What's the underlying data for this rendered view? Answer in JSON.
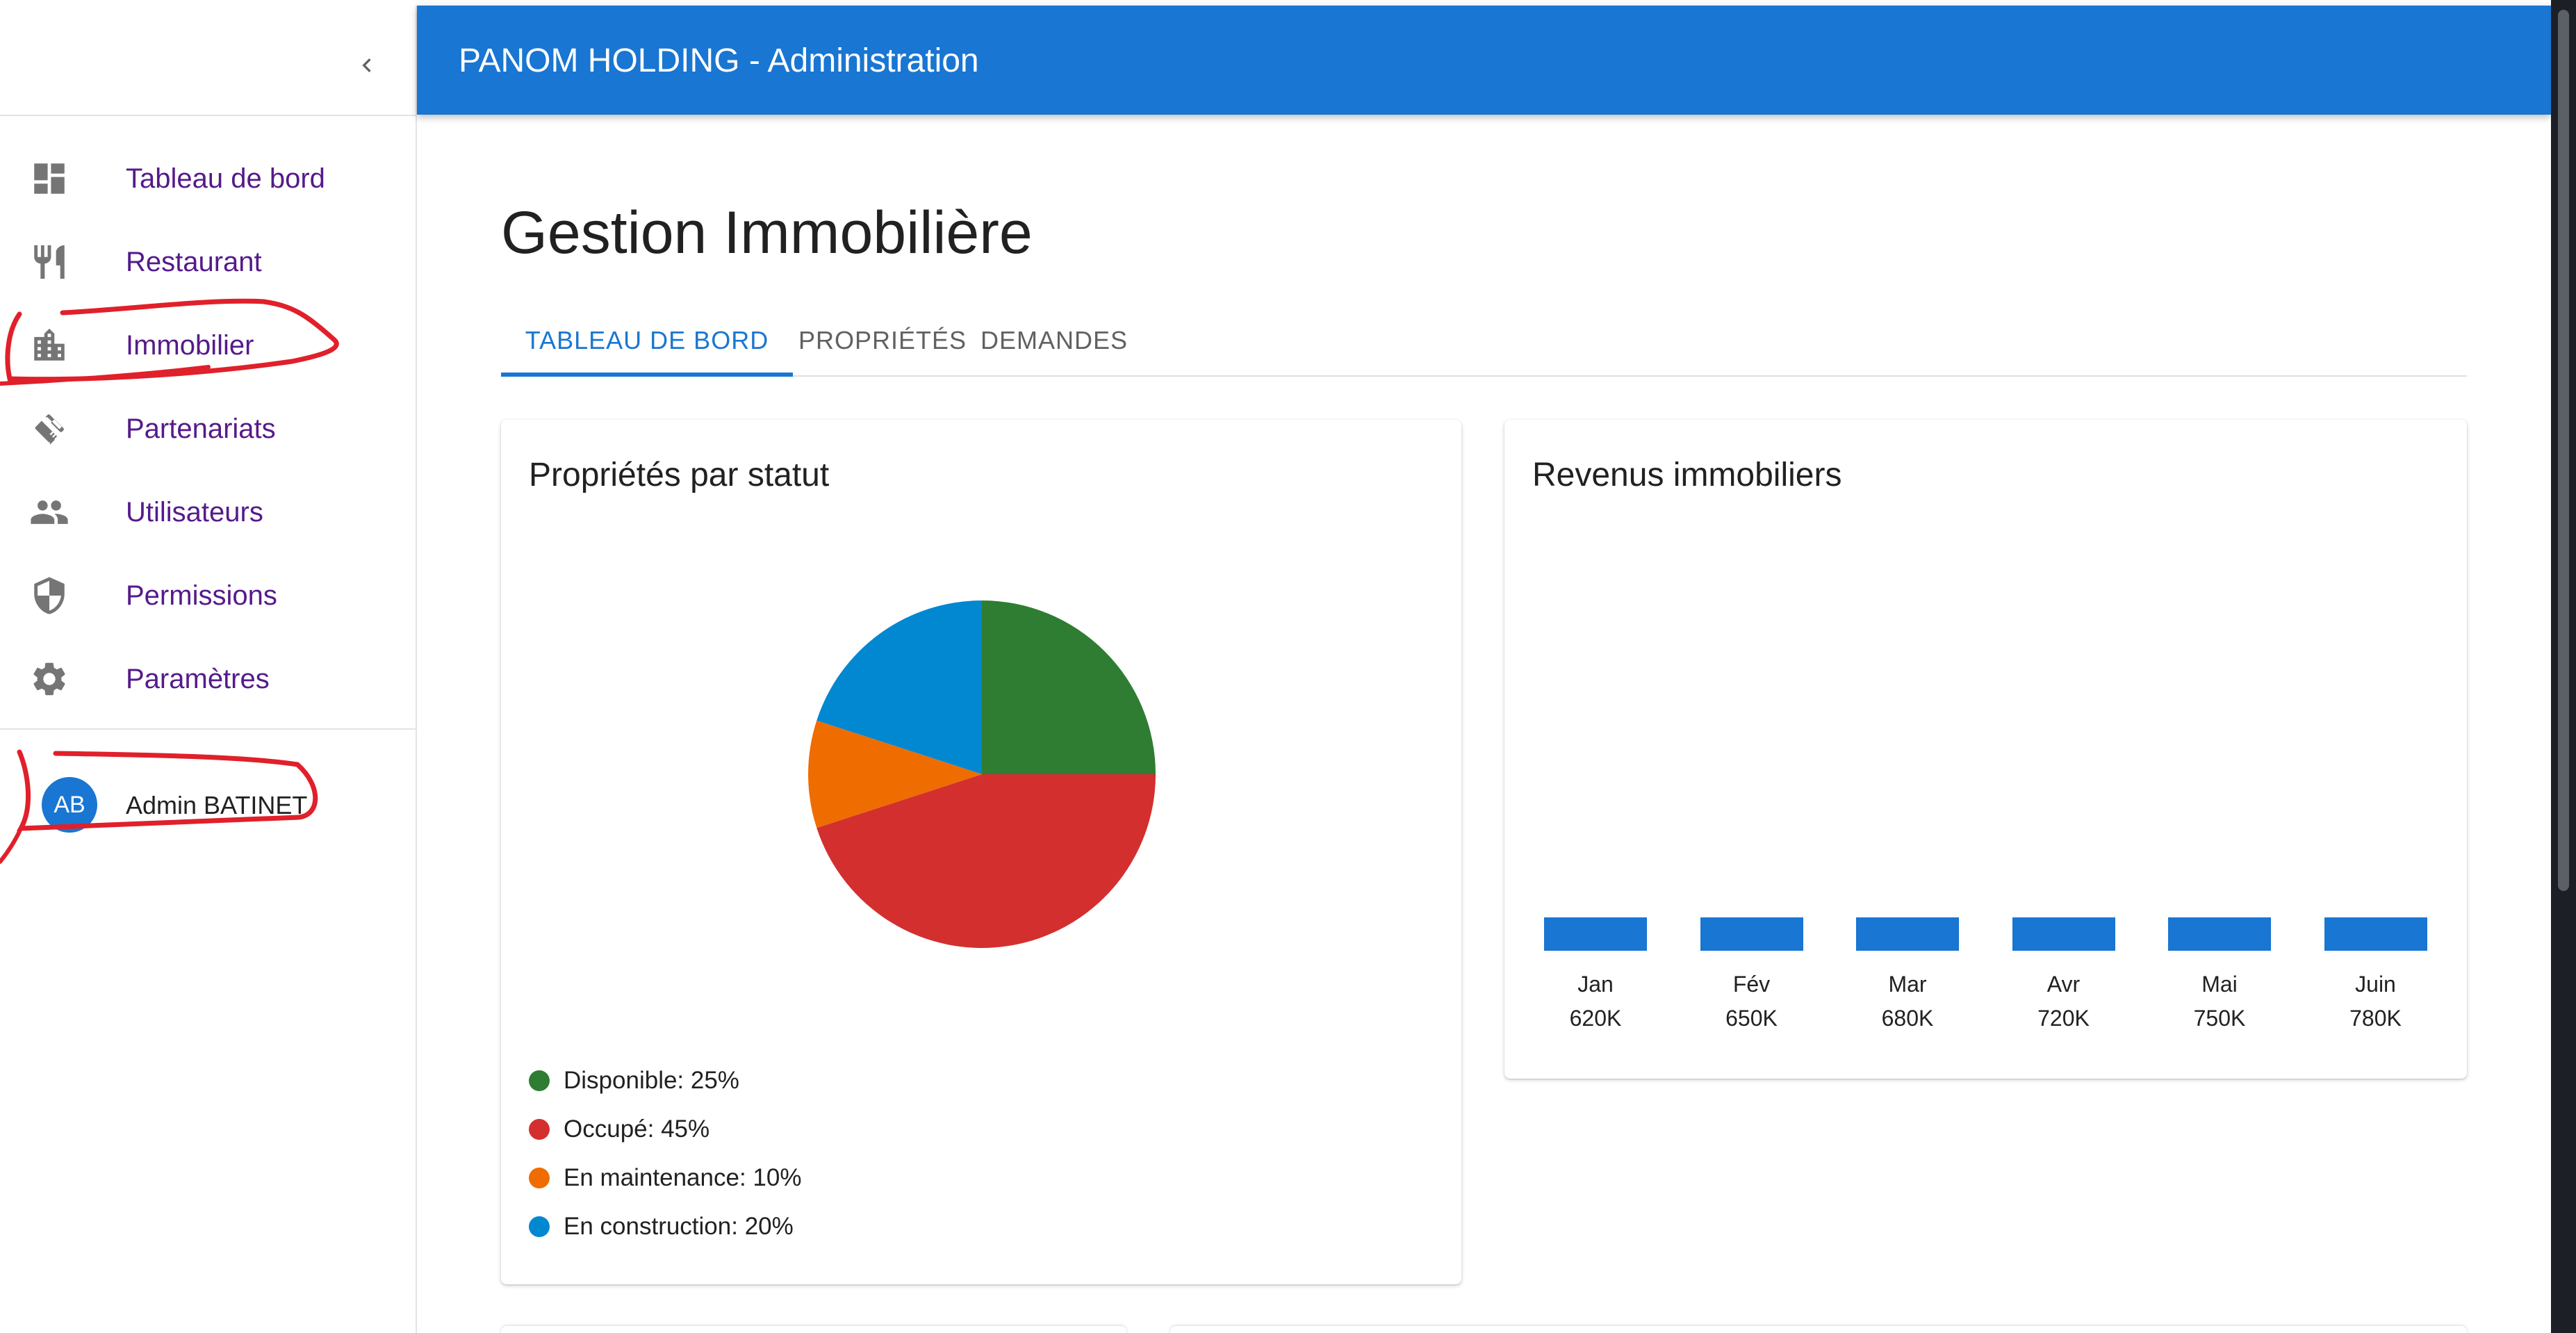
{
  "app": {
    "title": "PANOM HOLDING - Administration"
  },
  "sidebar": {
    "items": [
      {
        "label": "Tableau de bord",
        "icon": "dashboard-icon"
      },
      {
        "label": "Restaurant",
        "icon": "restaurant-icon"
      },
      {
        "label": "Immobilier",
        "icon": "building-icon"
      },
      {
        "label": "Partenariats",
        "icon": "handshake-icon"
      },
      {
        "label": "Utilisateurs",
        "icon": "people-icon"
      },
      {
        "label": "Permissions",
        "icon": "shield-icon"
      },
      {
        "label": "Paramètres",
        "icon": "gear-icon"
      }
    ],
    "user": {
      "initials": "AB",
      "name": "Admin BATINET"
    },
    "link_color": "#551a8b",
    "icon_color": "#757575"
  },
  "main": {
    "title": "Gestion Immobilière",
    "tabs": [
      {
        "label": "TABLEAU DE BORD",
        "active": true
      },
      {
        "label": "PROPRIÉTÉS",
        "active": false
      },
      {
        "label": "DEMANDES",
        "active": false
      }
    ],
    "accent": "#1976d2"
  },
  "cards": {
    "status": {
      "title": "Propriétés par statut",
      "legend": [
        {
          "label": "Disponible: 25%",
          "color": "#2e7d32"
        },
        {
          "label": "Occupé: 45%",
          "color": "#d32f2f"
        },
        {
          "label": "En maintenance: 10%",
          "color": "#ef6c00"
        },
        {
          "label": "En construction: 20%",
          "color": "#0288d1"
        }
      ]
    },
    "revenue": {
      "title": "Revenus immobiliers",
      "bar_color": "#1976d2"
    }
  },
  "chart_data": [
    {
      "type": "pie",
      "title": "Propriétés par statut",
      "categories": [
        "Disponible",
        "Occupé",
        "En maintenance",
        "En construction"
      ],
      "values": [
        25,
        45,
        10,
        20
      ],
      "colors": [
        "#2e7d32",
        "#d32f2f",
        "#ef6c00",
        "#0288d1"
      ],
      "legend": "bottom"
    },
    {
      "type": "bar",
      "title": "Revenus immobiliers",
      "categories": [
        "Jan",
        "Fév",
        "Mar",
        "Avr",
        "Mai",
        "Juin"
      ],
      "values": [
        620,
        650,
        680,
        720,
        750,
        780
      ],
      "value_labels": [
        "620K",
        "650K",
        "680K",
        "720K",
        "750K",
        "780K"
      ],
      "bar_color": "#1976d2"
    }
  ]
}
